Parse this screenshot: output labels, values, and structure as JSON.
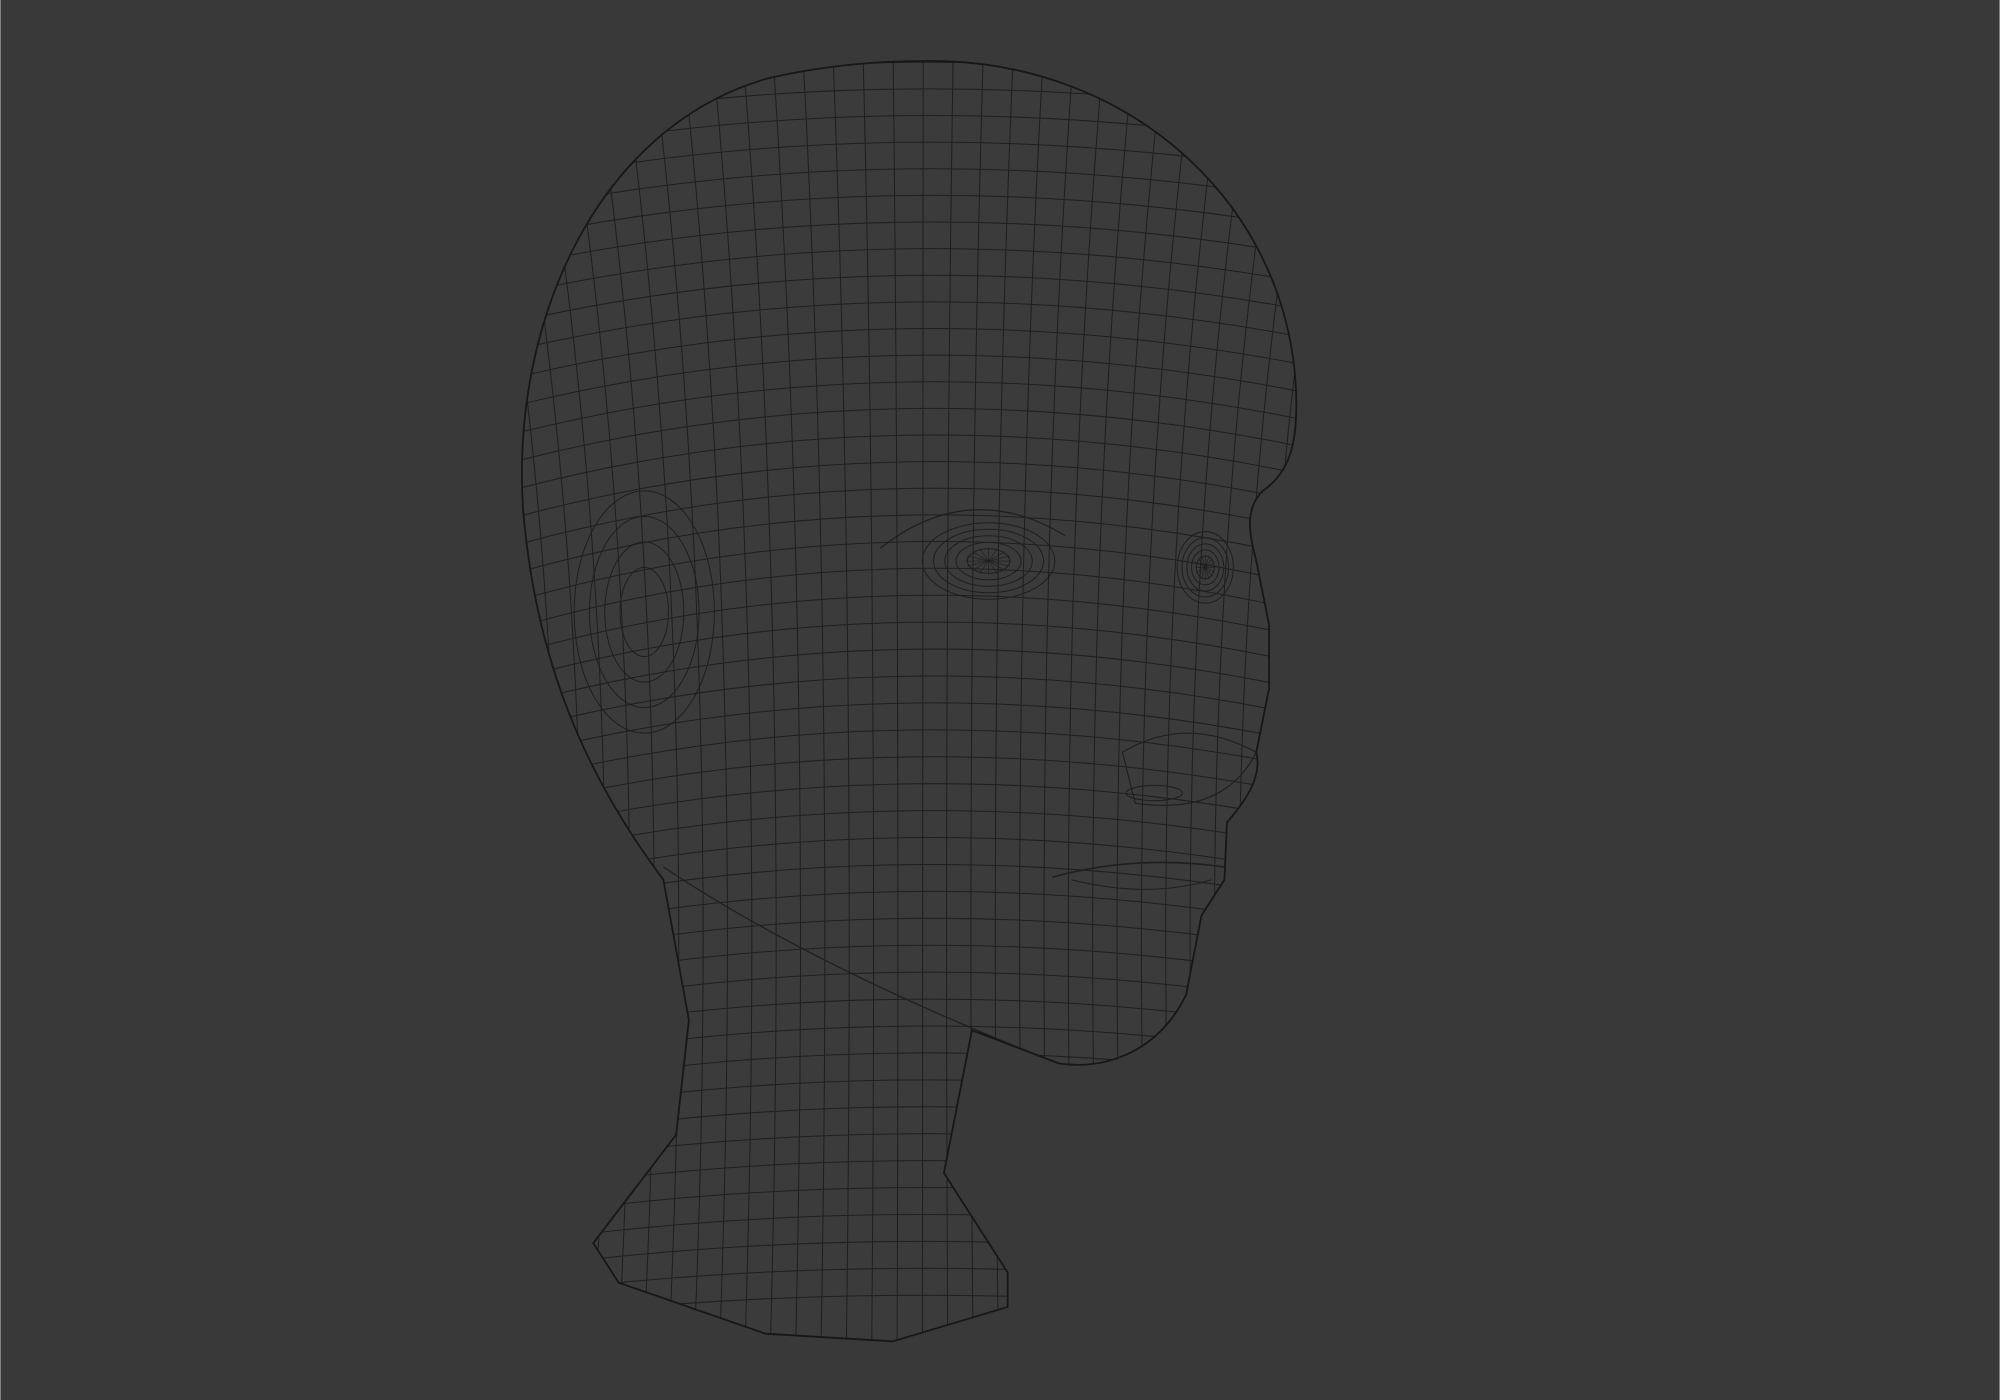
{
  "viewport": {
    "background_color": "#393939",
    "mesh_fill_color": "#3b3b3b",
    "wire_color": "#1f1f1f",
    "outline_color": "#171717"
  },
  "mesh": {
    "subject": "head",
    "render_mode": "wireframe"
  }
}
